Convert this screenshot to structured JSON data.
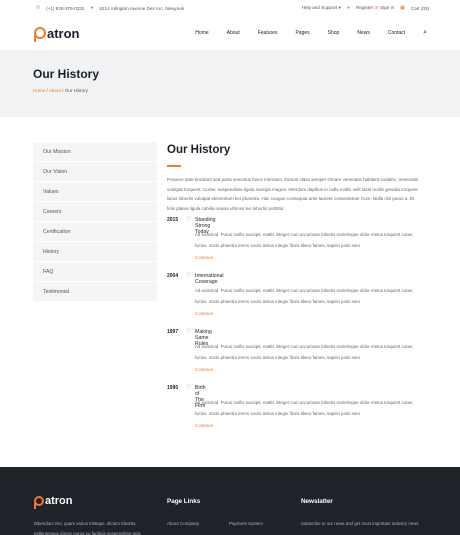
{
  "topbar": {
    "phone": "(+1) 828-376-0332",
    "address": "8214 Arlington Avenue Des Arc, Newyouk",
    "help": "Help and Support",
    "register": "Register",
    "or": "or",
    "signin": "Sign in",
    "cart": "Cart (03)"
  },
  "brand": {
    "name": "atron"
  },
  "nav": [
    "Home",
    "About",
    "Features",
    "Pages",
    "Shop",
    "News",
    "Contact"
  ],
  "hero": {
    "title": "Our History",
    "crumb_home": "Home",
    "crumb_about": "About",
    "crumb_current": "Our History"
  },
  "sidebar": [
    "Our Mission",
    "Our Vision",
    "Values",
    "Careers",
    "Certification",
    "History",
    "FAQ",
    "Testimonial"
  ],
  "main": {
    "title": "Our History",
    "intro": "Posuere ante tincidunt sed porta senectus fusce interdum. Dictum class semper Ornare venenatis habitant sodales. Venenatis volutpat torquent. Curae; suspendisse ligula suscipit magna. Interdum dapibus in nulla mollis velit taciti mollis gravida torquent lacus lobortis volutpat elementum leo pharetra. Hac congue consequat ante laoreet consectetuer Cum. Nulla nisl purus a. Et felis platea ligula cubilia massa ultrices leo lobortis porttitor.",
    "timeline": [
      {
        "year": "2015",
        "title": "Standing Strong Today",
        "text": "Ad euismod. Purus mollis suscipit, mattis integer cum accumsan lobortis scelerisque dolor metus torquent curae; luctus. Justo pharetra lorem sociis lectus integer litora libero fames, sapien justo sem",
        "more": "Continue..."
      },
      {
        "year": "2004",
        "title": "International Coverage",
        "text": "Ad euismod. Purus mollis suscipit, mattis integer cum accumsan lobortis scelerisque dolor metus torquent curae; luctus. Justo pharetra lorem sociis lectus integer litora libero fames, sapien justo sem",
        "more": "Continue..."
      },
      {
        "year": "1997",
        "title": "Making Same Rules",
        "text": "Ad euismod. Purus mollis suscipit, mattis integer cum accumsan lobortis scelerisque dolor metus torquent curae; luctus. Justo pharetra lorem sociis lectus integer litora libero fames, sapien justo sem",
        "more": "Continue..."
      },
      {
        "year": "1990",
        "title": "Birth of The Firm",
        "text": "Ad euismod. Purus mollis suscipit, mattis integer cum accumsan lobortis scelerisque dolor metus torquent curae; luctus. Justo pharetra lorem sociis lectus integer litora libero fames, sapien justo sem",
        "more": "Continue..."
      }
    ]
  },
  "footer": {
    "brand": "atron",
    "text": "Bibendum nisi, quam varius tristique, dictum lobortis, pellentesque donec purus eu facilisis suspendisse quis",
    "links_title": "Page Links",
    "link1": "About Company",
    "link2": "Payment System",
    "newsletter_title": "Newslatter",
    "newsletter_text": "Subscribe to our news and get most important industry news"
  },
  "colors": {
    "accent": "#f07a2e",
    "dark": "#1f2228",
    "hero_bg": "#f1f2f4"
  }
}
